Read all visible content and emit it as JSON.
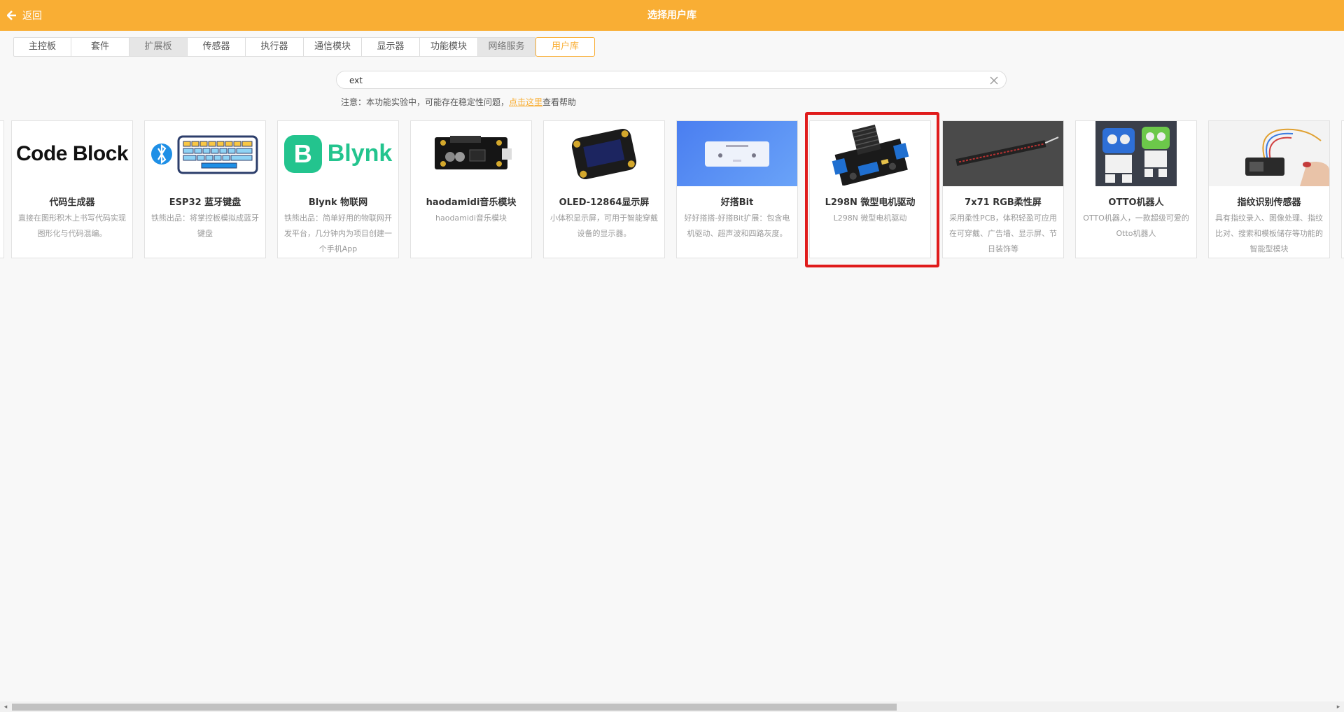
{
  "header": {
    "back_label": "返回",
    "title": "选择用户库"
  },
  "tabs": [
    {
      "label": "主控板"
    },
    {
      "label": "套件"
    },
    {
      "label": "扩展板"
    },
    {
      "label": "传感器"
    },
    {
      "label": "执行器"
    },
    {
      "label": "通信模块"
    },
    {
      "label": "显示器"
    },
    {
      "label": "功能模块"
    },
    {
      "label": "网络服务"
    },
    {
      "label": "用户库"
    }
  ],
  "search": {
    "value": "ext",
    "placeholder": ""
  },
  "notice": {
    "prefix": "注意：本功能实验中，可能存在稳定性问题，",
    "link": "点击这里",
    "suffix": "查看帮助"
  },
  "cards": [
    {
      "name": "代码生成器",
      "desc": "直接在图形积木上书写代码实现图形化与代码混编。",
      "logo_text": "Code Block"
    },
    {
      "name": "ESP32 蓝牙键盘",
      "desc": "铁熊出品：将掌控板模拟成蓝牙键盘"
    },
    {
      "name": "Blynk 物联网",
      "desc": "铁熊出品：简单好用的物联网开发平台，几分钟内为项目创建一个手机App",
      "logo_text": "Blynk",
      "logo_letter": "B"
    },
    {
      "name": "haodamidi音乐模块",
      "desc": "haodamidi音乐模块"
    },
    {
      "name": "OLED-12864显示屏",
      "desc": "小体积显示屏，可用于智能穿戴设备的显示器。"
    },
    {
      "name": "好搭Bit",
      "desc": "好好搭搭-好搭Bit扩展：包含电机驱动、超声波和四路灰度。"
    },
    {
      "name": "L298N 微型电机驱动",
      "desc": "L298N 微型电机驱动"
    },
    {
      "name": "7x71 RGB柔性屏",
      "desc": "采用柔性PCB，体积轻盈可应用在可穿戴、广告墙、显示屏、节日装饰等"
    },
    {
      "name": "OTTO机器人",
      "desc": "OTTO机器人，一款超级可爱的Otto机器人"
    },
    {
      "name": "指纹识别传感器",
      "desc": "具有指纹录入、图像处理、指纹比对、搜索和模板储存等功能的智能型模块"
    }
  ],
  "colors": {
    "accent": "#f9ae34",
    "highlight": "#e01c1c"
  }
}
